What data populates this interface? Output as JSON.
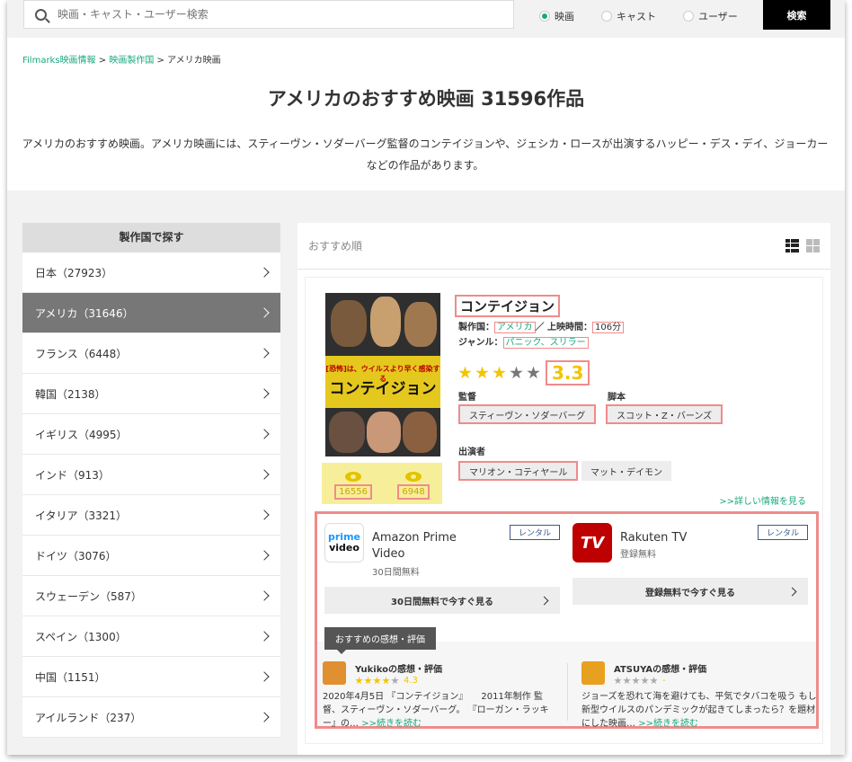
{
  "search": {
    "placeholder": "映画・キャスト・ユーザー検索",
    "button": "検索",
    "radios": [
      {
        "label": "映画",
        "selected": true
      },
      {
        "label": "キャスト",
        "selected": false
      },
      {
        "label": "ユーザー",
        "selected": false
      }
    ]
  },
  "breadcrumb": {
    "items": [
      "Filmarks映画情報",
      "映画製作国",
      "アメリカ映画"
    ],
    "separator": ">"
  },
  "page": {
    "title": "アメリカのおすすめ映画  31596作品",
    "description": "アメリカのおすすめ映画。アメリカ映画には、スティーヴン・ソダーバーグ監督のコンテイジョンや、ジェシカ・ロースが出演するハッピー・デス・デイ、ジョーカーなどの作品があります。"
  },
  "sidebar": {
    "heading": "製作国で探す",
    "items": [
      {
        "label": "日本（27923）",
        "active": false
      },
      {
        "label": "アメリカ（31646）",
        "active": true
      },
      {
        "label": "フランス（6448）",
        "active": false
      },
      {
        "label": "韓国（2138）",
        "active": false
      },
      {
        "label": "イギリス（4995）",
        "active": false
      },
      {
        "label": "インド（913）",
        "active": false
      },
      {
        "label": "イタリア（3321）",
        "active": false
      },
      {
        "label": "ドイツ（3076）",
        "active": false
      },
      {
        "label": "スウェーデン（587）",
        "active": false
      },
      {
        "label": "スペイン（1300）",
        "active": false
      },
      {
        "label": "中国（1151）",
        "active": false
      },
      {
        "label": "アイルランド（237）",
        "active": false
      }
    ]
  },
  "main": {
    "sort_label": "おすすめ順",
    "view_icons": [
      "list-view-icon",
      "grid-view-icon"
    ]
  },
  "movie": {
    "title": "コンテイジョン",
    "poster": {
      "caption": "[恐怖]は、ウイルスより早く感染する",
      "title_text": "コンテイジョン"
    },
    "country_label": "製作国：",
    "country": "アメリカ",
    "runtime_label": "／ 上映時間：",
    "runtime": "106分",
    "genre_label": "ジャンル：",
    "genres": "パニック、スリラー",
    "rating": "3.3",
    "rating_stars": 3.3,
    "director_label": "監督",
    "director": "スティーヴン・ソダーバーグ",
    "writer_label": "脚本",
    "writer": "スコット・Z・バーンズ",
    "cast_label": "出演者",
    "cast": [
      "マリオン・コティヤール",
      "マット・デイモン"
    ],
    "watched_count": "16556",
    "want_count": "6948",
    "more_link": ">>詳しい情報を見る"
  },
  "vod": {
    "providers": [
      {
        "name": "Amazon Prime Video",
        "sub": "30日間無料",
        "badge": "レンタル",
        "button": "30日間無料で今すぐ見る",
        "logo_text": "prime video",
        "color": "#1a98ff"
      },
      {
        "name": "Rakuten TV",
        "sub": "登録無料",
        "badge": "レンタル",
        "button": "登録無料で今すぐ見る",
        "logo_text": "TV",
        "color": "#bf0000"
      }
    ],
    "reviews_heading": "おすすめの感想・評価",
    "reviews": [
      {
        "user": "Yukikoの感想・評価",
        "score": "4.3",
        "stars": 4.3,
        "text": "2020年4月5日 『コンテイジョン』　　2011年制作 監督、スティーヴン・ソダーバーグ。 『ローガン・ラッキー』の…",
        "more": ">>続きを読む"
      },
      {
        "user": "ATSUYAの感想・評価",
        "score": "-",
        "stars": 0,
        "text": "ジョーズを恐れて海を避けても、平気でタバコを吸う もし新型ウイルスのパンデミックが起きてしまったら？を題材にした映画…",
        "more": ">>続きを読む"
      }
    ]
  }
}
